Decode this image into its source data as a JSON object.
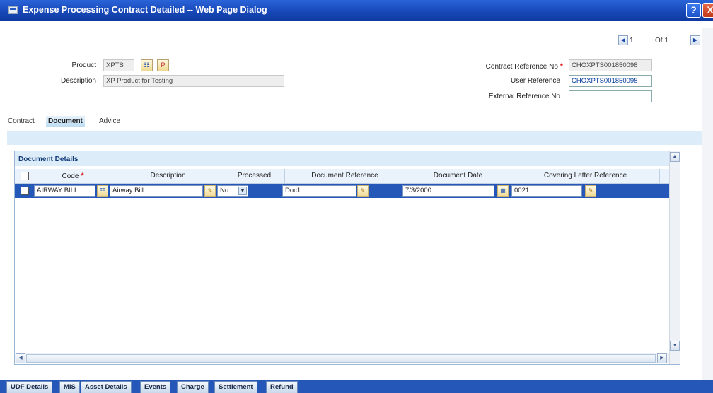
{
  "window": {
    "title": "Expense Processing Contract Detailed -- Web Page Dialog",
    "help_label": "?",
    "close_label": "X"
  },
  "pagination": {
    "prev_label": "◀",
    "current": "1",
    "of_label": "Of 1",
    "next_label": "▶"
  },
  "header": {
    "product_label": "Product",
    "product_value": "XPTS",
    "description_label": "Description",
    "description_value": "XP Product for Testing",
    "contract_ref_label": "Contract Reference No",
    "contract_ref_value": "CHOXPTS001850098",
    "user_ref_label": "User Reference",
    "user_ref_value": "CHOXPTS001850098",
    "external_ref_label": "External Reference No",
    "external_ref_value": ""
  },
  "tabs": [
    {
      "label": "Contract"
    },
    {
      "label": "Document"
    },
    {
      "label": "Advice"
    }
  ],
  "document_grid": {
    "title": "Document Details",
    "columns": [
      "Code",
      "Description",
      "Processed",
      "Document Reference",
      "Document Date",
      "Covering Letter Reference"
    ],
    "rows": [
      {
        "code": "AIRWAY BILL",
        "description": "Airway Bill",
        "processed": "No",
        "document_reference": "Doc1",
        "document_date": "7/3/2000",
        "covering_letter_reference": "0021"
      }
    ]
  },
  "bottom_tabs": [
    "UDF Details",
    "MIS",
    "Asset Details",
    "Events",
    "Charge",
    "Settlement",
    "Refund"
  ],
  "colors": {
    "title_bar": "#1848b8",
    "selected_row": "#2457b8",
    "grid_header": "#eaf2fb",
    "required": "#e02020"
  }
}
